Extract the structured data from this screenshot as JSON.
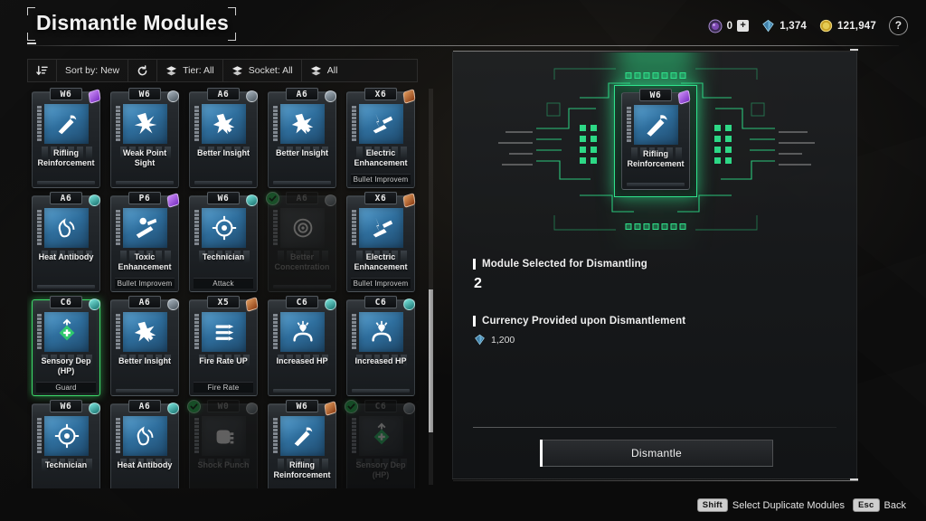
{
  "header": {
    "title": "Dismantle Modules"
  },
  "currency": {
    "orb": {
      "icon": "orb-icon",
      "value": "0",
      "plus_label": "+"
    },
    "crystal": {
      "icon": "crystal-icon",
      "value": "1,374"
    },
    "gold": {
      "icon": "gold-coin-icon",
      "value": "121,947"
    },
    "help_label": "?"
  },
  "toolbar": {
    "sort_icon": "sort-descending-icon",
    "sort_label": "Sort by: New",
    "reset_icon": "refresh-icon",
    "tier_icon": "layers-icon",
    "tier_label": "Tier: All",
    "socket_icon": "layers-icon",
    "socket_label": "Socket: All",
    "all_icon": "layers-icon",
    "all_label": "All"
  },
  "grid": {
    "cards": [
      {
        "tier": "W6",
        "name": "Rifling Reinforcement",
        "sub": "",
        "rarity": "purple",
        "icon": "rifling-icon",
        "selected": false,
        "dimmed": false,
        "checked": false
      },
      {
        "tier": "W6",
        "name": "Weak Point Sight",
        "sub": "",
        "rarity": "socket",
        "icon": "burst-icon",
        "selected": false,
        "dimmed": false,
        "checked": false
      },
      {
        "tier": "A6",
        "name": "Better Insight",
        "sub": "",
        "rarity": "socket",
        "icon": "insight-icon",
        "selected": false,
        "dimmed": false,
        "checked": false
      },
      {
        "tier": "A6",
        "name": "Better Insight",
        "sub": "",
        "rarity": "socket",
        "icon": "insight-icon",
        "selected": false,
        "dimmed": false,
        "checked": false
      },
      {
        "tier": "X6",
        "name": "Electric Enhancement",
        "sub": "Bullet Improvem",
        "rarity": "bronze",
        "icon": "electric-icon",
        "selected": false,
        "dimmed": false,
        "checked": false
      },
      {
        "tier": "A6",
        "name": "Heat Antibody",
        "sub": "",
        "rarity": "teal",
        "icon": "heat-icon",
        "selected": false,
        "dimmed": false,
        "checked": false
      },
      {
        "tier": "P6",
        "name": "Toxic Enhancement",
        "sub": "Bullet Improvem",
        "rarity": "purple",
        "icon": "toxic-icon",
        "selected": false,
        "dimmed": false,
        "checked": false
      },
      {
        "tier": "W6",
        "name": "Technician",
        "sub": "Attack",
        "rarity": "teal",
        "icon": "technician-icon",
        "selected": false,
        "dimmed": false,
        "checked": false
      },
      {
        "tier": "A6",
        "name": "Better Concentration",
        "sub": "",
        "rarity": "grey",
        "icon": "concentration-icon",
        "selected": false,
        "dimmed": true,
        "checked": true
      },
      {
        "tier": "X6",
        "name": "Electric Enhancement",
        "sub": "Bullet Improvem",
        "rarity": "bronze",
        "icon": "electric-icon",
        "selected": false,
        "dimmed": false,
        "checked": false
      },
      {
        "tier": "C6",
        "name": "Sensory Dep (HP)",
        "sub": "Guard",
        "rarity": "teal",
        "icon": "sensory-hp-icon",
        "selected": true,
        "dimmed": false,
        "checked": false
      },
      {
        "tier": "A6",
        "name": "Better Insight",
        "sub": "",
        "rarity": "socket",
        "icon": "insight-icon",
        "selected": false,
        "dimmed": false,
        "checked": false
      },
      {
        "tier": "X5",
        "name": "Fire Rate UP",
        "sub": "Fire Rate",
        "rarity": "bronze",
        "icon": "fire-rate-icon",
        "selected": false,
        "dimmed": false,
        "checked": false
      },
      {
        "tier": "C6",
        "name": "Increased HP",
        "sub": "",
        "rarity": "teal",
        "icon": "increased-hp-icon",
        "selected": false,
        "dimmed": false,
        "checked": false
      },
      {
        "tier": "C6",
        "name": "Increased HP",
        "sub": "",
        "rarity": "teal",
        "icon": "increased-hp-icon",
        "selected": false,
        "dimmed": false,
        "checked": false
      },
      {
        "tier": "W6",
        "name": "Technician",
        "sub": "",
        "rarity": "teal",
        "icon": "technician-icon",
        "selected": false,
        "dimmed": false,
        "checked": false
      },
      {
        "tier": "A6",
        "name": "Heat Antibody",
        "sub": "",
        "rarity": "teal",
        "icon": "heat-icon",
        "selected": false,
        "dimmed": false,
        "checked": false
      },
      {
        "tier": "W0",
        "name": "Shock Punch",
        "sub": "",
        "rarity": "grey",
        "icon": "shock-punch-icon",
        "selected": false,
        "dimmed": true,
        "checked": true
      },
      {
        "tier": "W6",
        "name": "Rifling Reinforcement",
        "sub": "",
        "rarity": "bronze",
        "icon": "rifling-icon",
        "selected": false,
        "dimmed": false,
        "checked": false
      },
      {
        "tier": "C6",
        "name": "Sensory Dep (HP)",
        "sub": "",
        "rarity": "grey",
        "icon": "sensory-hp-icon",
        "selected": false,
        "dimmed": true,
        "checked": true
      }
    ]
  },
  "detail": {
    "featured": {
      "tier": "W6",
      "name": "Rifling Reinforcement",
      "rarity": "purple",
      "icon": "rifling-icon"
    },
    "selected_label": "Module Selected for Dismantling",
    "selected_count": "2",
    "currency_label": "Currency Provided upon Dismantlement",
    "currency_icon": "crystal-icon",
    "currency_value": "1,200",
    "dismantle_label": "Dismantle"
  },
  "footer": {
    "shift_key": "Shift",
    "shift_label": "Select Duplicate Modules",
    "esc_key": "Esc",
    "esc_label": "Back"
  },
  "colors": {
    "accent_green": "#2fe38c",
    "select_green": "#3ddc6a",
    "rarity_purple": "#9b4fd6",
    "rarity_bronze": "#c06a2a",
    "rarity_teal": "#3fc9bf"
  }
}
